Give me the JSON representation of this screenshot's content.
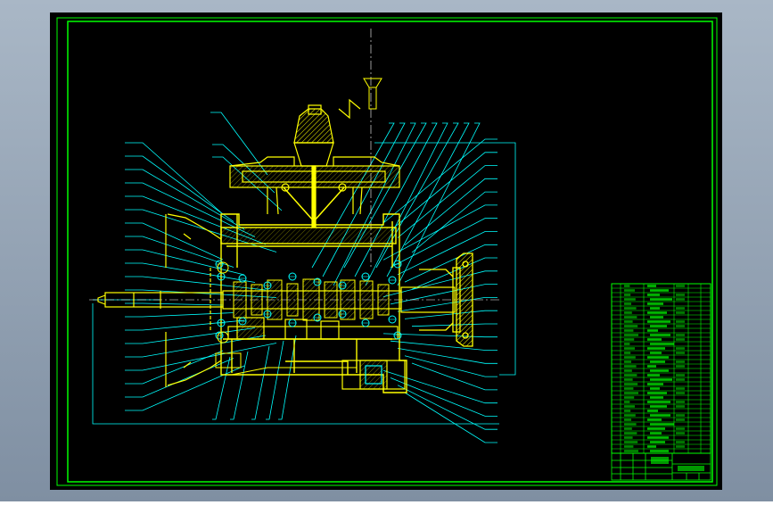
{
  "window": {
    "background_gradient": [
      "#a9b7c6",
      "#7f8fa2"
    ],
    "canvas_color": "#000000"
  },
  "drawing": {
    "subject": "gearbox-cross-section-assembly",
    "colors": {
      "border": "#00ff00",
      "section_lines": "#ffff00",
      "leaders": "#00ffff",
      "bearings": "#00ffff",
      "hatching": "#ffff00",
      "title_block": "#00ff00",
      "table_text": "#00ff00"
    },
    "left_balloon_count": 21,
    "top_balloon_count": 9,
    "right_balloon_count": 24,
    "bom_row_count": 38
  }
}
